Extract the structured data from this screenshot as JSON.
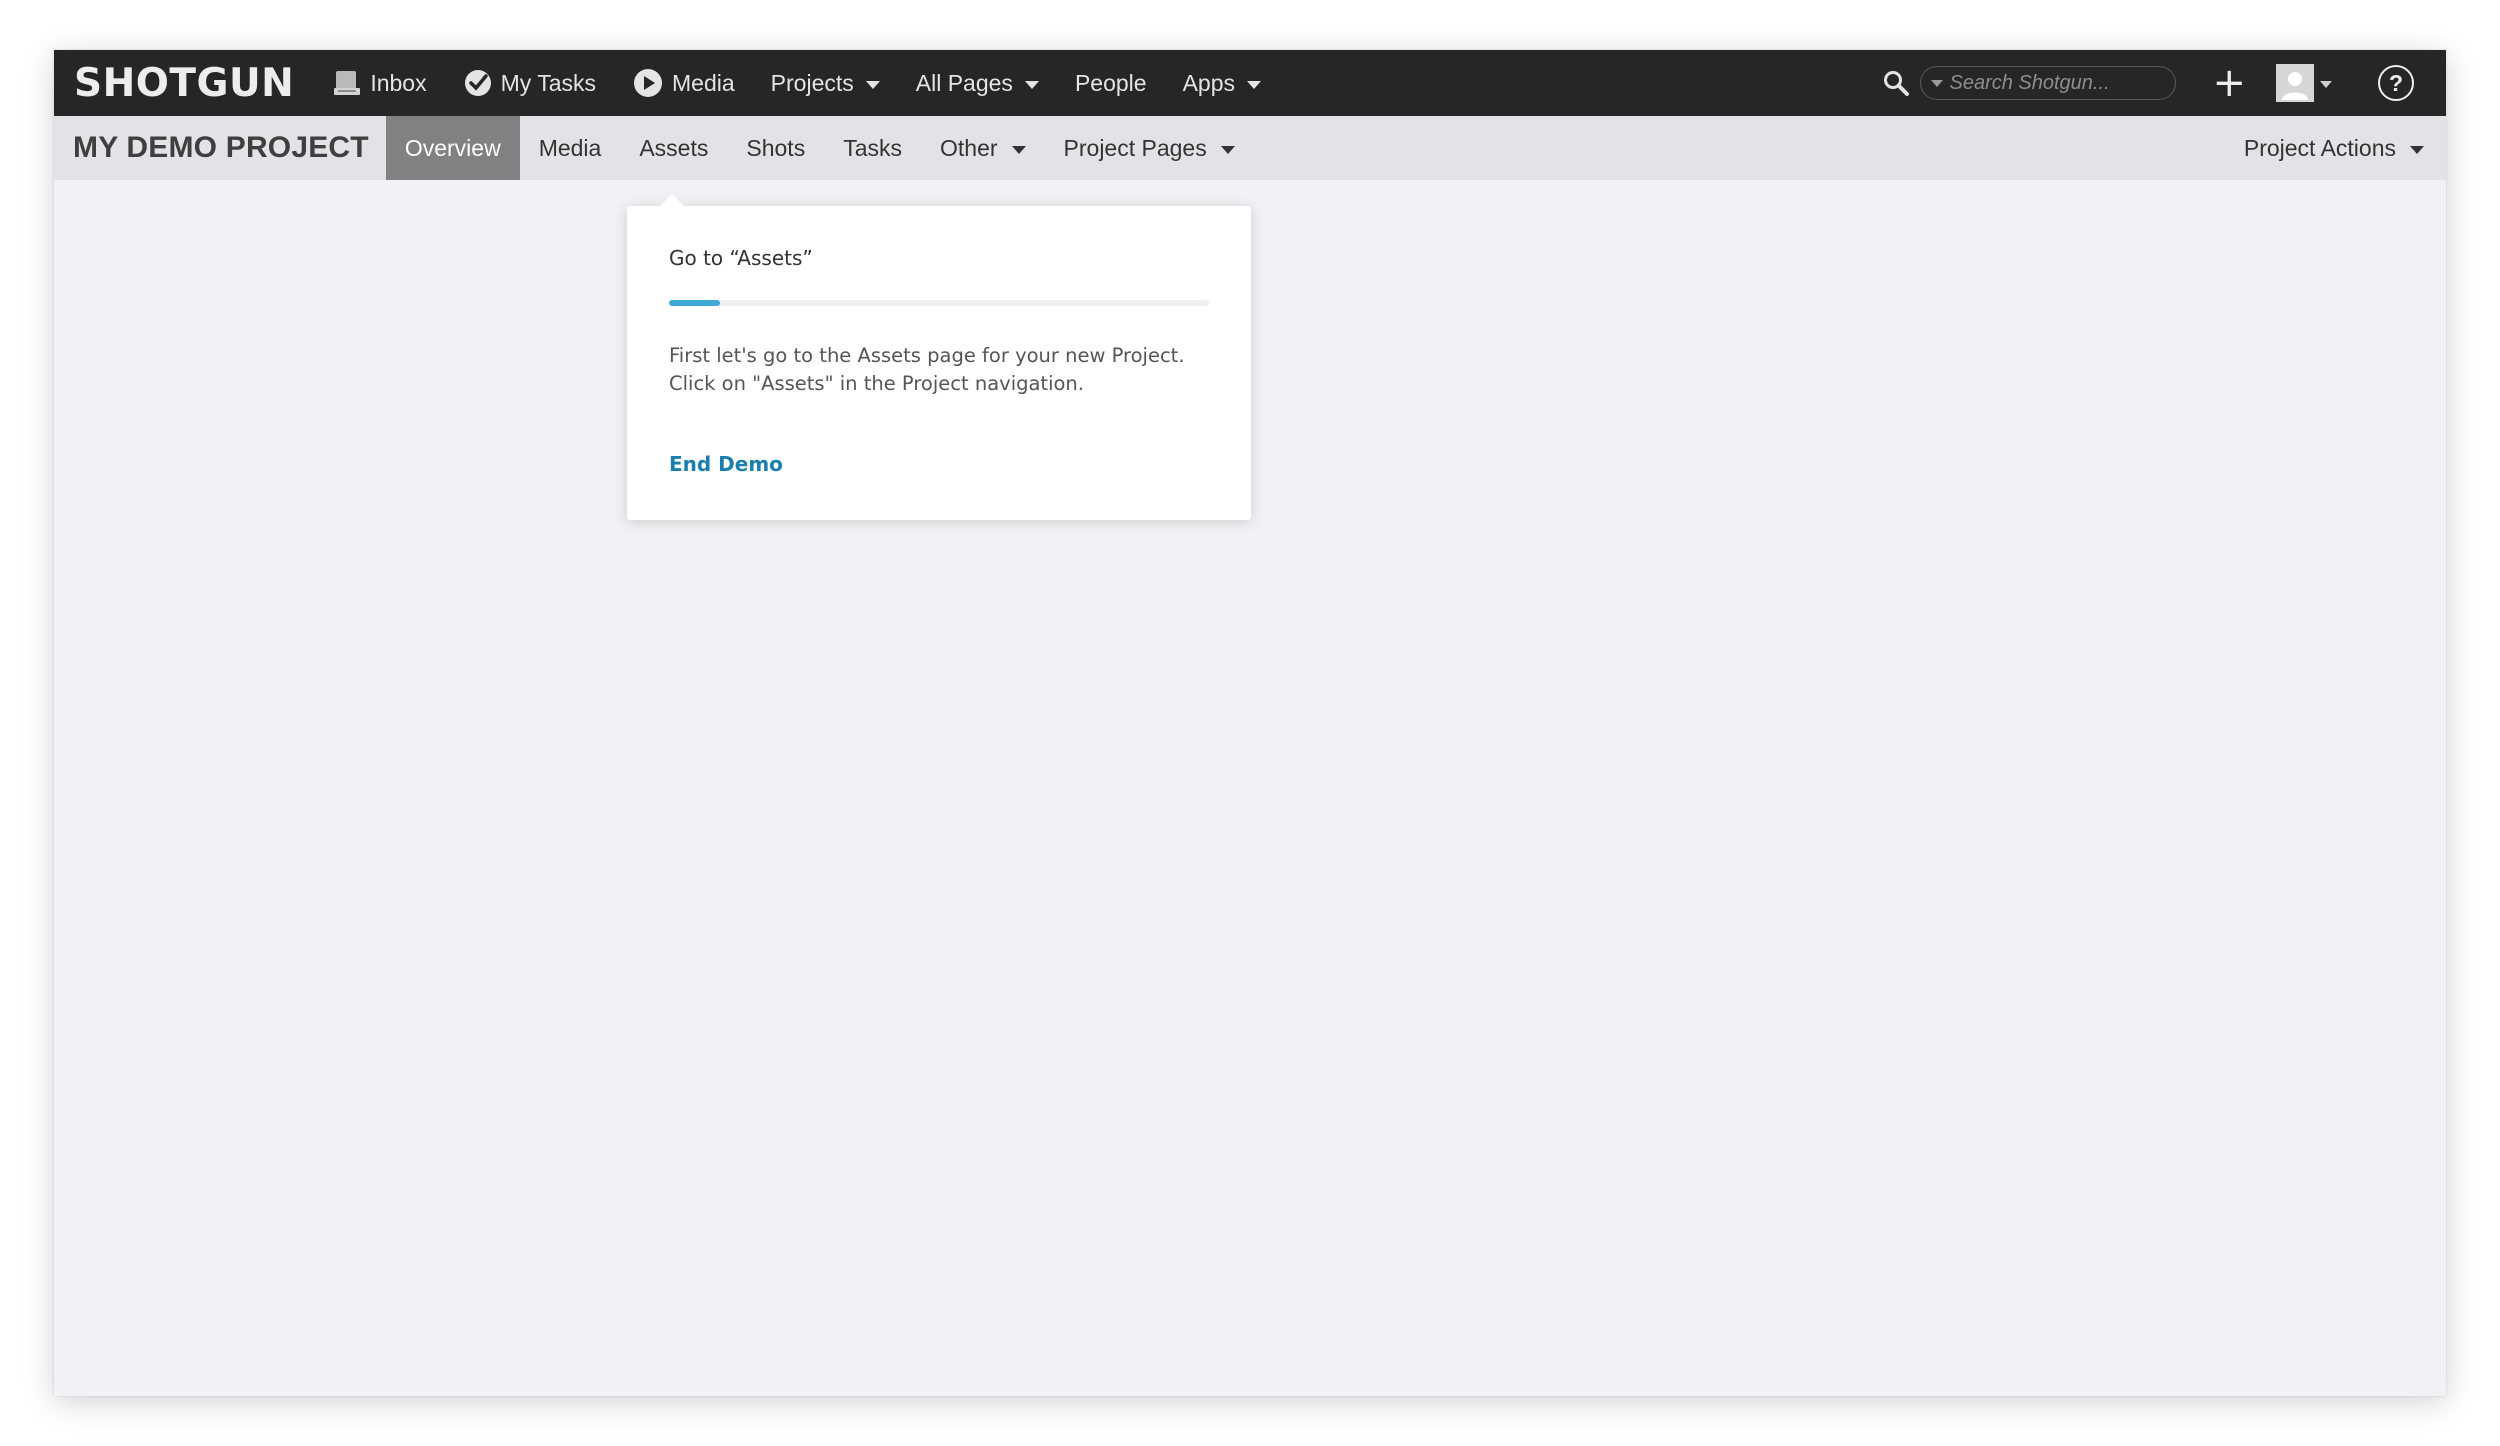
{
  "app": {
    "logo": "SHOTGUN"
  },
  "topnav": {
    "items": [
      {
        "label": "Inbox",
        "icon": "inbox-icon"
      },
      {
        "label": "My Tasks",
        "icon": "check-circle-icon"
      },
      {
        "label": "Media",
        "icon": "play-circle-icon"
      },
      {
        "label": "Projects",
        "dropdown": true
      },
      {
        "label": "All Pages",
        "dropdown": true
      },
      {
        "label": "People"
      },
      {
        "label": "Apps",
        "dropdown": true
      }
    ],
    "search_placeholder": "Search Shotgun...",
    "add_label": "+",
    "help_label": "?"
  },
  "project": {
    "title": "MY DEMO PROJECT",
    "tabs": [
      {
        "label": "Overview",
        "active": true
      },
      {
        "label": "Media"
      },
      {
        "label": "Assets"
      },
      {
        "label": "Shots"
      },
      {
        "label": "Tasks"
      },
      {
        "label": "Other",
        "dropdown": true
      },
      {
        "label": "Project Pages",
        "dropdown": true
      }
    ],
    "actions_label": "Project Actions"
  },
  "tour": {
    "title": "Go to “Assets”",
    "progress": 0.095,
    "body_line1": "First let's go to the Assets page for your new Project.",
    "body_line2": "Click on \"Assets\" in the Project navigation.",
    "end_label": "End Demo"
  },
  "colors": {
    "topbar_bg": "#262626",
    "projbar_bg": "#e2e3e6",
    "active_tab_bg": "#7f8183",
    "progress_fill": "#3fa9d8",
    "link": "#1b7fae",
    "content_bg": "#f1f2f5"
  }
}
